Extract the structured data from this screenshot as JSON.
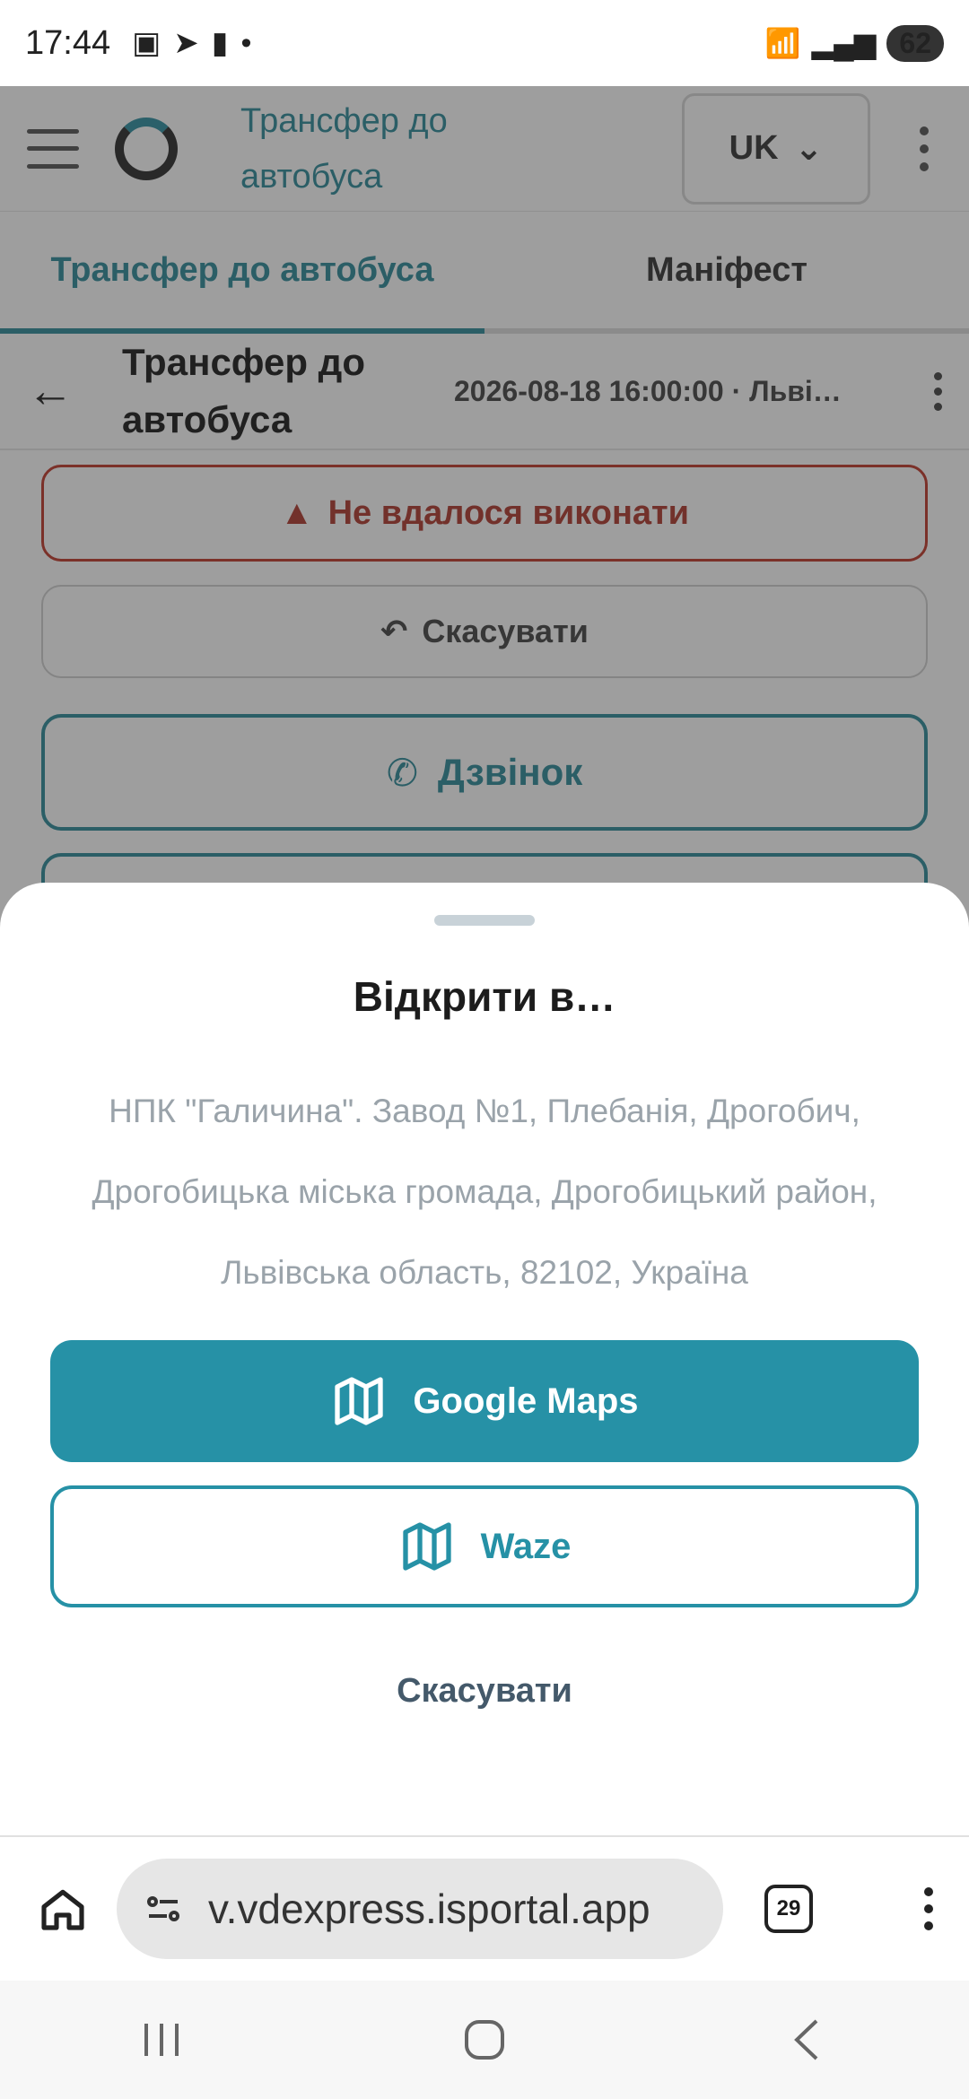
{
  "status_bar": {
    "time": "17:44",
    "battery": "62",
    "wifi_label": "6"
  },
  "app": {
    "title": "Трансфер до автобуса",
    "language": "UK"
  },
  "tabs": [
    {
      "label": "Трансфер до автобуса",
      "active": true
    },
    {
      "label": "Маніфест",
      "active": false
    }
  ],
  "subheader": {
    "title": "Трансфер до автобуса",
    "datetime": "2026-08-18 16:00:00 · Льві…"
  },
  "actions": {
    "fail_label": "Не вдалося виконати",
    "undo_label": "Скасувати",
    "call_label": "Дзвінок"
  },
  "sheet": {
    "title": "Відкрити в…",
    "address": "НПК \"Галичина\". Завод №1, Плебанія, Дрогобич, Дрогобицька міська громада, Дрогобицький район, Львівська область, 82102, Україна",
    "google_maps_label": "Google Maps",
    "waze_label": "Waze",
    "cancel_label": "Скасувати"
  },
  "browser": {
    "url": "v.vdexpress.isportal.app",
    "tab_count": "29"
  },
  "colors": {
    "accent": "#2691a6",
    "danger": "#b03a2e",
    "muted_text": "#9aa3aa"
  }
}
